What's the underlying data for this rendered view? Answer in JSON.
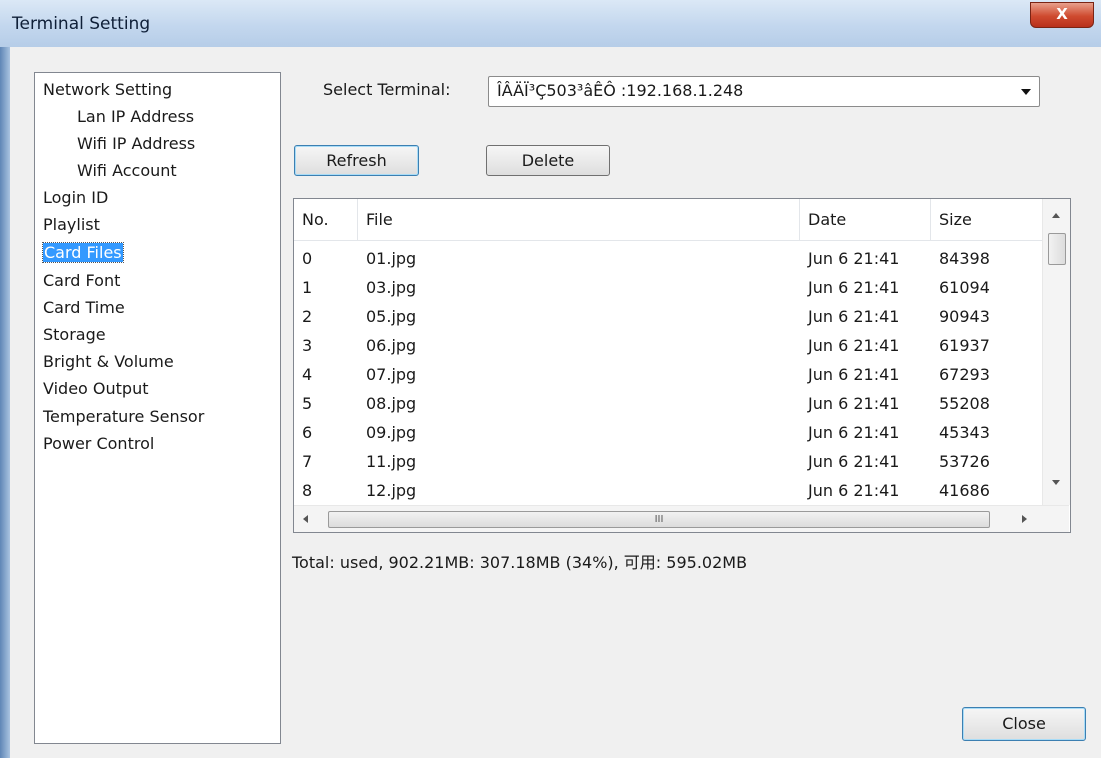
{
  "window": {
    "title": "Terminal Setting",
    "close_glyph": "X"
  },
  "nav": {
    "items": [
      {
        "label": "Network Setting"
      },
      {
        "label": "Lan IP Address"
      },
      {
        "label": "Wifi IP Address"
      },
      {
        "label": "Wifi Account"
      },
      {
        "label": "Login ID"
      },
      {
        "label": "Playlist"
      },
      {
        "label": "Card Files",
        "selected": true
      },
      {
        "label": "Card Font"
      },
      {
        "label": "Card Time"
      },
      {
        "label": "Storage"
      },
      {
        "label": "Bright & Volume"
      },
      {
        "label": "Video Output"
      },
      {
        "label": "Temperature Sensor"
      },
      {
        "label": "Power Control"
      }
    ]
  },
  "terminal": {
    "label": "Select Terminal:",
    "selected_value": "ÎÂÄÏ³Ç503³âÊÔ :192.168.1.248"
  },
  "buttons": {
    "refresh": "Refresh",
    "delete": "Delete",
    "close": "Close"
  },
  "file_list": {
    "columns": [
      "No.",
      "File",
      "Date",
      "Size"
    ],
    "rows": [
      {
        "no": "0",
        "file": "01.jpg",
        "date": "Jun 6 21:41",
        "size": "84398"
      },
      {
        "no": "1",
        "file": "03.jpg",
        "date": "Jun 6 21:41",
        "size": "61094"
      },
      {
        "no": "2",
        "file": "05.jpg",
        "date": "Jun 6 21:41",
        "size": "90943"
      },
      {
        "no": "3",
        "file": "06.jpg",
        "date": "Jun 6 21:41",
        "size": "61937"
      },
      {
        "no": "4",
        "file": "07.jpg",
        "date": "Jun 6 21:41",
        "size": "67293"
      },
      {
        "no": "5",
        "file": "08.jpg",
        "date": "Jun 6 21:41",
        "size": "55208"
      },
      {
        "no": "6",
        "file": "09.jpg",
        "date": "Jun 6 21:41",
        "size": "45343"
      },
      {
        "no": "7",
        "file": "11.jpg",
        "date": "Jun 6 21:41",
        "size": "53726"
      },
      {
        "no": "8",
        "file": "12.jpg",
        "date": "Jun 6 21:41",
        "size": "41686"
      }
    ],
    "hscroll_grip": "III"
  },
  "storage": {
    "total_text": "Total: used, 902.21MB: 307.18MB (34%), 可用: 595.02MB"
  },
  "colors": {
    "selection": "#3399ff",
    "title_bar": "#c3d7ee",
    "close_button": "#cf4a2f"
  }
}
